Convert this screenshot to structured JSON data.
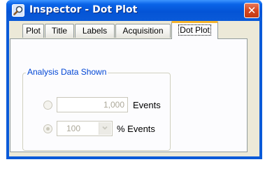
{
  "window": {
    "title": "Inspector - Dot Plot",
    "title_icon": "magnifier-icon",
    "close_icon": "close-icon",
    "close_glyph": "✕"
  },
  "tabs": [
    {
      "label": "Plot",
      "active": false
    },
    {
      "label": "Title",
      "active": false
    },
    {
      "label": "Labels",
      "active": false
    },
    {
      "label": "Acquisition",
      "active": false
    },
    {
      "label": "Dot Plot",
      "active": true
    }
  ],
  "group": {
    "label": "Analysis Data Shown",
    "options": [
      {
        "value": "1,000",
        "unit_label": "Events",
        "selected": false,
        "enabled": false
      },
      {
        "value": "100",
        "unit_label": "% Events",
        "selected": true,
        "enabled": false
      }
    ]
  },
  "colors": {
    "titlebar": "#0a5ad8",
    "active_tab_accent": "#f5b62f",
    "group_label": "#0046d5",
    "close_button": "#d5461f"
  }
}
